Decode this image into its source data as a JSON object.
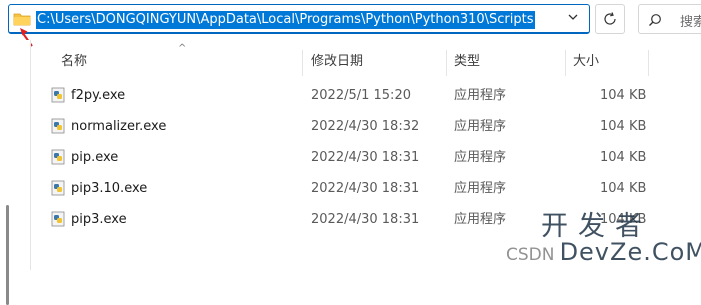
{
  "address_bar": {
    "path": "C:\\Users\\DONGQINGYUN\\AppData\\Local\\Programs\\Python\\Python310\\Scripts",
    "dropdown_glyph": "⌵",
    "refresh_glyph": "↻",
    "search_placeholder": "搜索"
  },
  "columns": {
    "name": "名称",
    "date": "修改日期",
    "type": "类型",
    "size": "大小",
    "sort_glyph": "^"
  },
  "files": [
    {
      "name": "f2py.exe",
      "date": "2022/5/1 15:20",
      "type": "应用程序",
      "size": "104 KB"
    },
    {
      "name": "normalizer.exe",
      "date": "2022/4/30 18:32",
      "type": "应用程序",
      "size": "104 KB"
    },
    {
      "name": "pip.exe",
      "date": "2022/4/30 18:31",
      "type": "应用程序",
      "size": "104 KB"
    },
    {
      "name": "pip3.10.exe",
      "date": "2022/4/30 18:31",
      "type": "应用程序",
      "size": "104 KB"
    },
    {
      "name": "pip3.exe",
      "date": "2022/4/30 18:31",
      "type": "应用程序",
      "size": "104 KB"
    }
  ],
  "watermark": {
    "top": "开发者",
    "csdn": "CSDN",
    "devze": "DevZe.CoM"
  },
  "colors": {
    "selection": "#0078d7",
    "focus_border": "#0067c0",
    "annotation_arrow": "#e02020",
    "folder": "#f5c242"
  },
  "icons": {
    "address_folder": "folder-icon",
    "file": "python-exe-icon",
    "search": "search-icon",
    "refresh": "refresh-icon"
  }
}
